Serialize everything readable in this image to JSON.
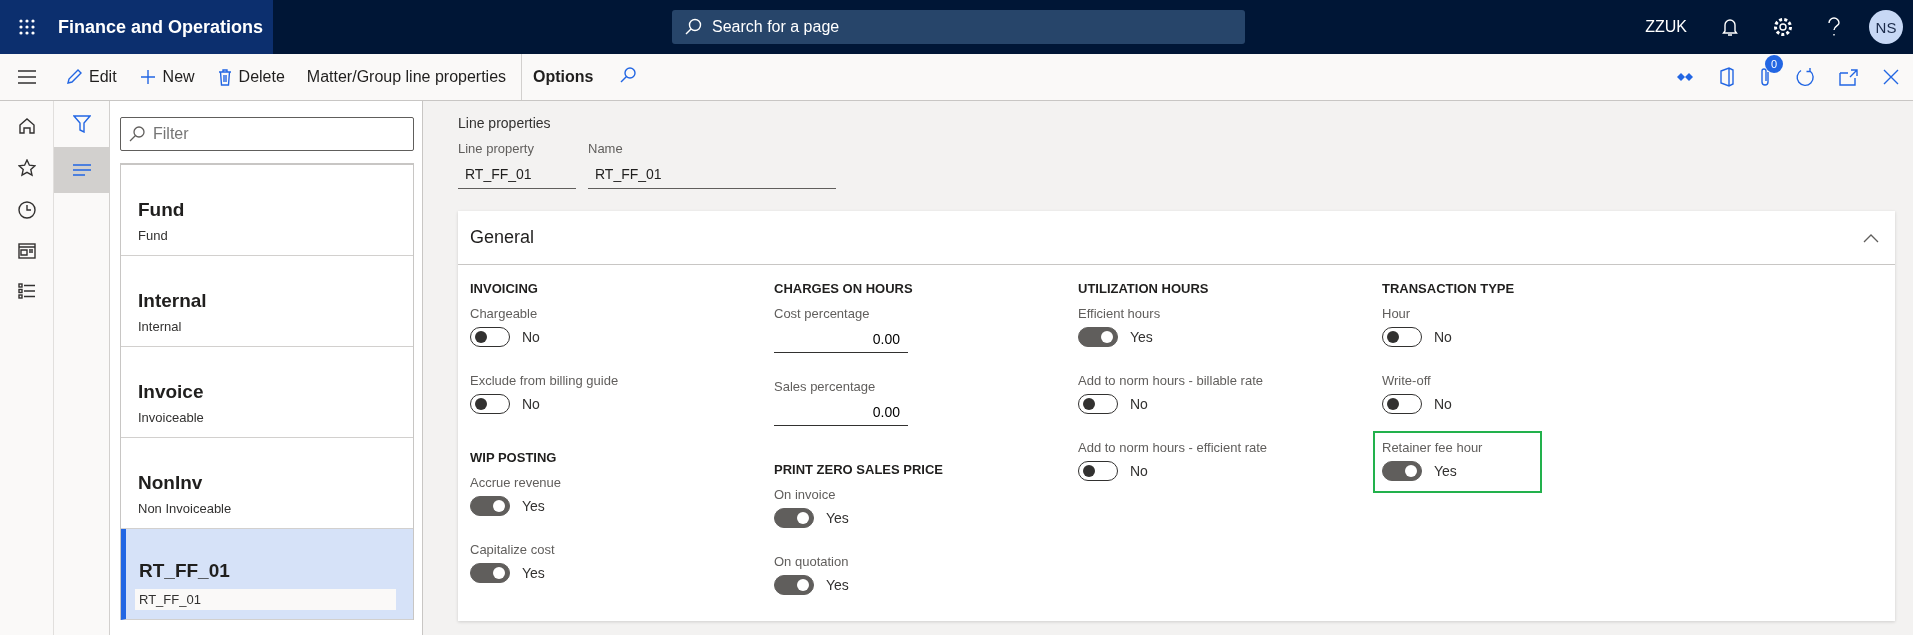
{
  "top_bar": {
    "app_name": "Finance and Operations",
    "search": {
      "placeholder": "Search for a page"
    },
    "company": "ZZUK",
    "avatar": "NS"
  },
  "toolbar": {
    "actions": [
      {
        "kind": "edit",
        "label": "Edit"
      },
      {
        "kind": "new",
        "label": "New"
      },
      {
        "kind": "delete",
        "label": "Delete"
      },
      {
        "kind": "text",
        "label": "Matter/Group line properties"
      },
      {
        "kind": "options",
        "label": "Options"
      }
    ],
    "attachments_count": "0"
  },
  "nav_rail": {
    "filter_pane": {
      "selected": false
    },
    "list_view": {
      "selected": true
    }
  },
  "list": {
    "filter": {
      "placeholder": "Filter"
    },
    "items": [
      {
        "title": "Fund",
        "subtitle": "Fund",
        "selected": false
      },
      {
        "title": "Internal",
        "subtitle": "Internal",
        "selected": false
      },
      {
        "title": "Invoice",
        "subtitle": "Invoiceable",
        "selected": false
      },
      {
        "title": "NonInv",
        "subtitle": "Non Invoiceable",
        "selected": false
      },
      {
        "title": "RT_FF_01",
        "subtitle": "RT_FF_01",
        "selected": true
      }
    ]
  },
  "header": {
    "title": "Line properties",
    "fields": [
      {
        "label": "Line property",
        "value": "RT_FF_01"
      },
      {
        "label": "Name",
        "value": "RT_FF_01"
      }
    ]
  },
  "general": {
    "title": "General",
    "expanded": true,
    "columns": [
      {
        "sections": [
          {
            "title": "INVOICING",
            "fields": [
              {
                "kind": "toggle",
                "label": "Chargeable",
                "on": false,
                "value": "No"
              },
              {
                "kind": "toggle",
                "label": "Exclude from billing guide",
                "on": false,
                "value": "No"
              }
            ]
          },
          {
            "title": "WIP POSTING",
            "fields": [
              {
                "kind": "toggle",
                "label": "Accrue revenue",
                "on": true,
                "value": "Yes"
              },
              {
                "kind": "toggle",
                "label": "Capitalize cost",
                "on": true,
                "value": "Yes"
              }
            ]
          }
        ]
      },
      {
        "sections": [
          {
            "title": "CHARGES ON HOURS",
            "fields": [
              {
                "kind": "number",
                "label": "Cost percentage",
                "value": "0.00"
              },
              {
                "kind": "number",
                "label": "Sales percentage",
                "value": "0.00"
              }
            ]
          },
          {
            "title": "PRINT ZERO SALES PRICE",
            "fields": [
              {
                "kind": "toggle",
                "label": "On invoice",
                "on": true,
                "value": "Yes"
              },
              {
                "kind": "toggle",
                "label": "On quotation",
                "on": true,
                "value": "Yes"
              }
            ]
          }
        ]
      },
      {
        "sections": [
          {
            "title": "UTILIZATION HOURS",
            "fields": [
              {
                "kind": "toggle",
                "label": "Efficient hours",
                "on": true,
                "value": "Yes"
              },
              {
                "kind": "toggle",
                "label": "Add to norm hours - billable rate",
                "on": false,
                "value": "No"
              },
              {
                "kind": "toggle",
                "label": "Add to norm hours - efficient rate",
                "on": false,
                "value": "No"
              }
            ]
          }
        ]
      },
      {
        "sections": [
          {
            "title": "TRANSACTION TYPE",
            "fields": [
              {
                "kind": "toggle",
                "label": "Hour",
                "on": false,
                "value": "No"
              },
              {
                "kind": "toggle",
                "label": "Write-off",
                "on": false,
                "value": "No"
              },
              {
                "kind": "toggle",
                "label": "Retainer fee hour",
                "on": true,
                "value": "Yes",
                "highlighted": true
              }
            ]
          }
        ]
      }
    ]
  }
}
